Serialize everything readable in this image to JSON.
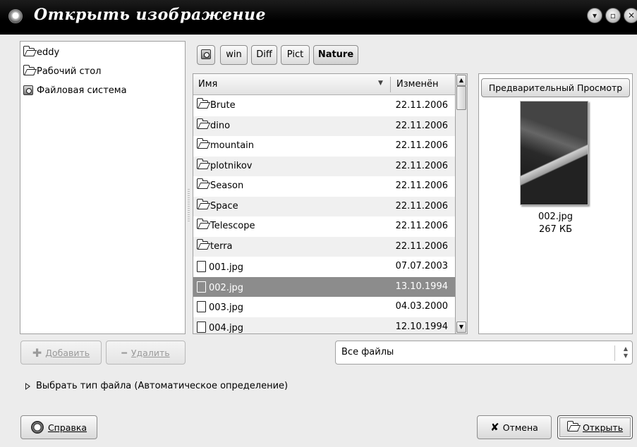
{
  "window": {
    "title": "Открыть изображение"
  },
  "places": {
    "items": [
      {
        "label": "eddy",
        "icon": "folder-icon"
      },
      {
        "label": "Рабочий стол",
        "icon": "folder-icon"
      },
      {
        "label": "Файловая система",
        "icon": "drive-icon"
      }
    ]
  },
  "pathbar": {
    "buttons": [
      "win",
      "Diff",
      "Pict",
      "Nature"
    ],
    "active": "Nature"
  },
  "filelist": {
    "columns": {
      "name": "Имя",
      "modified": "Изменён"
    },
    "rows": [
      {
        "name": "Brute",
        "date": "22.11.2006",
        "type": "folder"
      },
      {
        "name": "dino",
        "date": "22.11.2006",
        "type": "folder"
      },
      {
        "name": "mountain",
        "date": "22.11.2006",
        "type": "folder"
      },
      {
        "name": "plotnikov",
        "date": "22.11.2006",
        "type": "folder"
      },
      {
        "name": "Season",
        "date": "22.11.2006",
        "type": "folder"
      },
      {
        "name": "Space",
        "date": "22.11.2006",
        "type": "folder"
      },
      {
        "name": "Telescope",
        "date": "22.11.2006",
        "type": "folder"
      },
      {
        "name": "terra",
        "date": "22.11.2006",
        "type": "folder"
      },
      {
        "name": "001.jpg",
        "date": "07.07.2003",
        "type": "file"
      },
      {
        "name": "002.jpg",
        "date": "13.10.1994",
        "type": "file",
        "selected": true
      },
      {
        "name": "003.jpg",
        "date": "04.03.2000",
        "type": "file"
      },
      {
        "name": "004.jpg",
        "date": "12.10.1994",
        "type": "file"
      }
    ]
  },
  "preview": {
    "button_label": "Предварительный Просмотр",
    "file_name": "002.jpg",
    "file_size": "267 КБ"
  },
  "actions": {
    "add_label": "Добавить",
    "remove_label": "Удалить",
    "filter_value": "Все файлы",
    "filetype_expander": "Выбрать тип файла (Автоматическое определение)",
    "help_label": "Справка",
    "cancel_label": "Отмена",
    "open_label": "Открыть"
  },
  "colors": {
    "titlebar": "#000000",
    "selection": "#8c8c8c",
    "row_alt": "#f0f0f0"
  }
}
